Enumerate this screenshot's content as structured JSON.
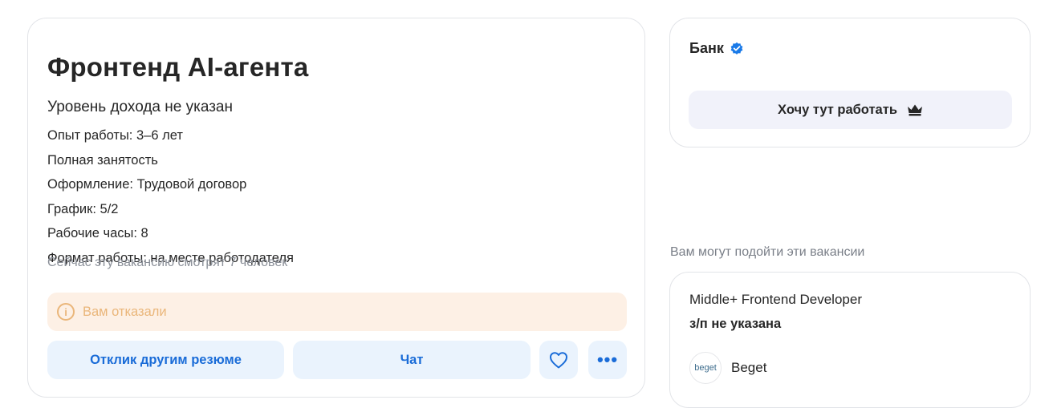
{
  "vacancy": {
    "title": "Фронтенд AI-агента",
    "salary": "Уровень дохода не указан",
    "details": [
      "Опыт работы: 3–6 лет",
      "Полная занятость",
      "Оформление: Трудовой договор",
      "График: 5/2",
      "Рабочие часы: 8",
      "Формат работы: на месте работодателя"
    ],
    "views": "Сейчас эту вакансию смотрят 7 человек",
    "status": {
      "text": "Вам отказали",
      "icon": "info-icon",
      "color": "#eab67a",
      "background": "#fdf0e5"
    },
    "actions": {
      "resume_label": "Отклик другим резюме",
      "chat_label": "Чат",
      "like_icon": "heart-icon",
      "more_label": "•••"
    }
  },
  "employer": {
    "name": "Банк",
    "verified_icon": "verified-check-icon",
    "want_label": "Хочу тут работать",
    "want_icon": "crown-icon"
  },
  "similar": {
    "heading": "Вам могут подойти эти вакансии",
    "items": [
      {
        "title": "Middle+ Frontend Developer",
        "salary": "з/п не указана",
        "company": "Beget",
        "logo_text": "beget"
      }
    ]
  },
  "colors": {
    "accent": "#1a6cd8",
    "button_bg": "#eaf3fd",
    "verified": "#1a7ae8"
  }
}
